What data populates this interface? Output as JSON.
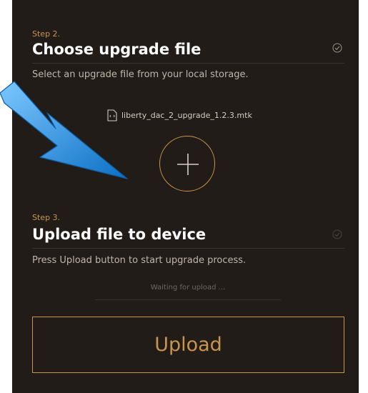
{
  "step2": {
    "label": "Step 2.",
    "title": "Choose upgrade file",
    "description": "Select an upgrade file from your local storage.",
    "status_icon": "check-circle-icon",
    "selected_file": "liberty_dac_2_upgrade_1.2.3.mtk",
    "file_icon": "file-icon",
    "add_icon": "plus-icon"
  },
  "step3": {
    "label": "Step 3.",
    "title": "Upload file to device",
    "description": "Press Upload button to start upgrade process.",
    "status_icon": "check-circle-icon",
    "progress_text": "Waiting for upload ...",
    "upload_label": "Upload"
  },
  "annotation": {
    "icon": "blue-arrow-icon"
  },
  "colors": {
    "panel_bg": "#221c18",
    "accent": "#c9944e",
    "title": "#ffffff",
    "text": "#bdb6ad",
    "arrow": "#1f8fe0"
  }
}
